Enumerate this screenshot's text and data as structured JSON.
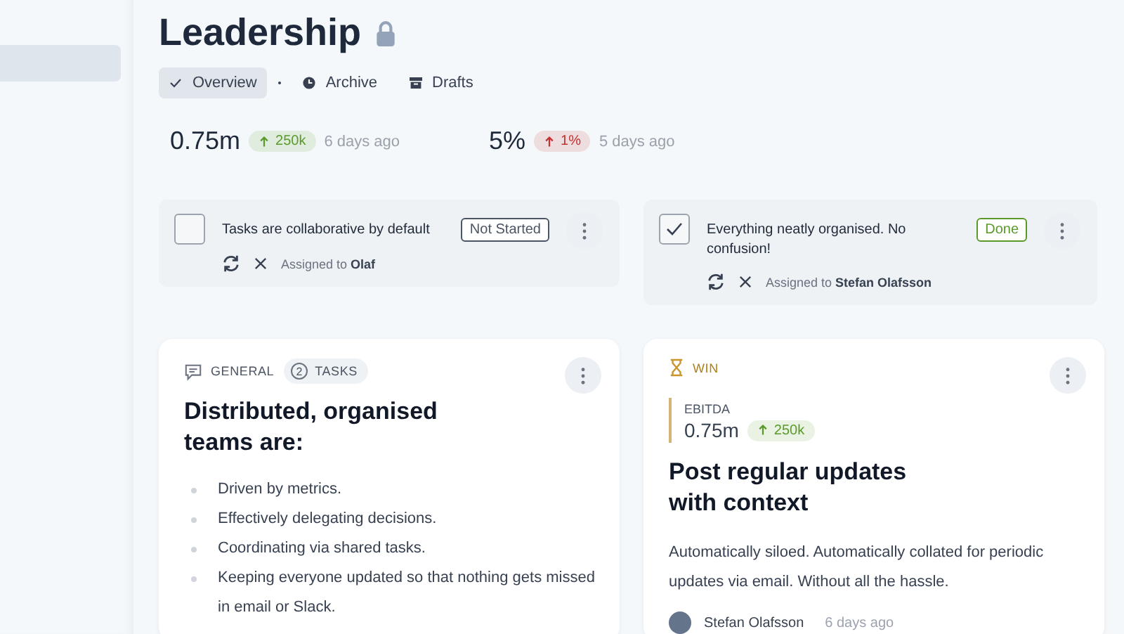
{
  "sidebar": {
    "items": [
      {
        "selected": true
      }
    ]
  },
  "page": {
    "title": "Leadership",
    "locked": true
  },
  "tabs": [
    {
      "label": "Overview",
      "selected": true
    },
    {
      "label": "Archive",
      "selected": false
    },
    {
      "label": "Drafts",
      "selected": false
    }
  ],
  "metrics": [
    {
      "value": "0.75m",
      "change": "250k",
      "color": "#5a9a2a",
      "time": "6 days ago"
    },
    {
      "value": "5%",
      "change": "1%",
      "color": "#c53030",
      "time": "5 days ago"
    }
  ],
  "tasks": [
    {
      "text": "Tasks are collaborative by default",
      "checked": false,
      "status": "Not Started",
      "color": "#4b5563",
      "assigned_prefix": "Assigned to",
      "assignee": "Olaf"
    },
    {
      "text": "Everything neatly organised. No confusion!",
      "checked": true,
      "status": "Done",
      "color": "#5a9a2a",
      "assigned_prefix": "Assigned to",
      "assignee": "Stefan Olafsson"
    }
  ],
  "cards": [
    {
      "kind": "general",
      "category": "GENERAL",
      "task_count": "2",
      "task_label": "TASKS",
      "title": "Distributed, organised teams are:",
      "bullets": [
        "Driven by metrics.",
        "Effectively delegating decisions.",
        "Coordinating via shared tasks.",
        "Keeping everyone updated so that nothing gets missed in email or Slack."
      ]
    },
    {
      "kind": "win",
      "category": "WIN",
      "metric": {
        "label": "EBITDA",
        "value": "0.75m",
        "change": "250k",
        "color": "#5a9a2a"
      },
      "title": "Post regular updates with context",
      "body": "Automatically siloed. Automatically collated for periodic updates via email. Without all the hassle.",
      "author": "Stefan Olafsson",
      "time": "6 days ago"
    }
  ]
}
